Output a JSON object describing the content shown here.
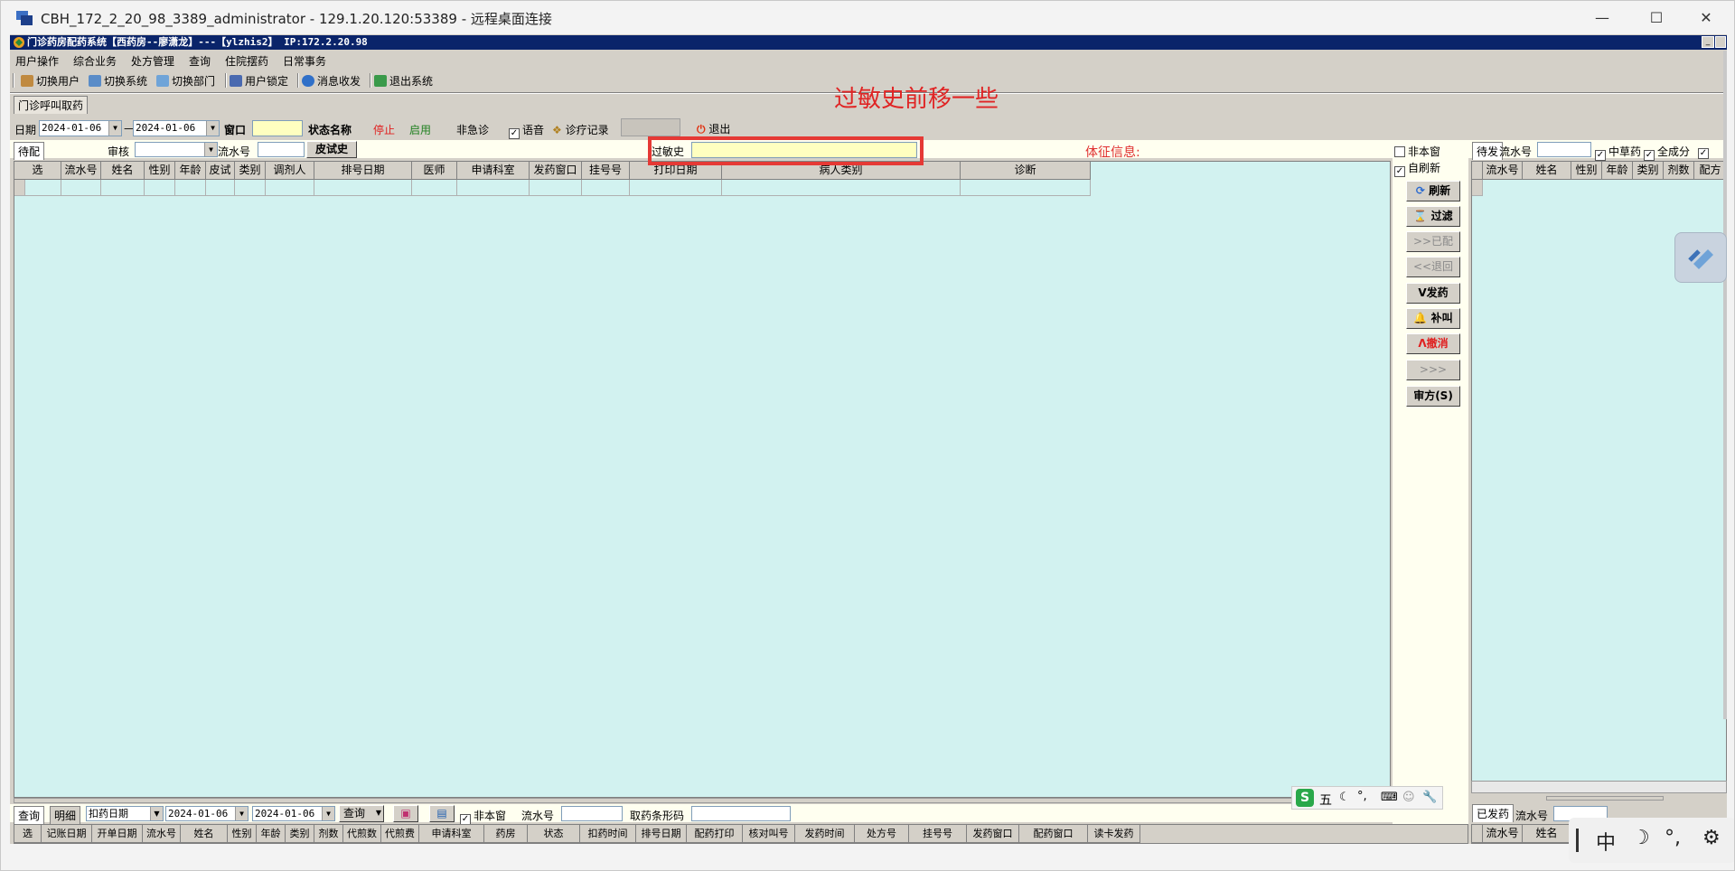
{
  "rdp": {
    "title": "CBH_172_2_20_98_3389_administrator - 129.1.20.120:53389 - 远程桌面连接",
    "minimize": "—",
    "maximize": "☐",
    "close": "✕"
  },
  "app": {
    "title": "门诊药房配药系统【西药房--廖潇龙】---【ylzhis2】 IP:172.2.20.98",
    "menu": [
      "用户操作",
      "综合业务",
      "处方管理",
      "查询",
      "住院摆药",
      "日常事务"
    ],
    "toolbar": [
      "切换用户",
      "切换系统",
      "切换部门",
      "用户锁定",
      "消息收发",
      "退出系统"
    ],
    "tab": "门诊呼叫取药"
  },
  "filter": {
    "date_label": "日期",
    "date_from": "2024-01-06",
    "dash": "—",
    "date_to": "2024-01-06",
    "window_label": "窗口",
    "window_value": "",
    "status_label": "状态名称",
    "stop": "停止",
    "enable": "启用",
    "non_urgent": "非急诊",
    "voice": "语音",
    "visit_record": "诊疗记录",
    "exit": "退出"
  },
  "pending": {
    "tab": "待配",
    "review_label": "审核",
    "serial_label": "流水号",
    "skin_test_btn": "皮试史",
    "allergy_label": "过敏史",
    "vitals_label": "体征信息:",
    "columns": [
      "选",
      "流水号",
      "姓名",
      "性别",
      "年龄",
      "皮试",
      "类别",
      "调剂人",
      "排号日期",
      "医师",
      "申请科室",
      "发药窗口",
      "挂号号",
      "打印日期",
      "病人类别",
      "诊断"
    ]
  },
  "side": {
    "non_window": "非本窗",
    "auto_refresh": "自刷新",
    "buttons": [
      "刷新",
      "过滤",
      ">>已配",
      "<<退回",
      "V发药",
      "补叫",
      "Λ撤消",
      ">>>",
      "审方(S)"
    ]
  },
  "right": {
    "tab": "待发",
    "serial_label": "流水号",
    "chinese_herb": "中草药",
    "all_components": "全成分",
    "columns": [
      "流水号",
      "姓名",
      "性别",
      "年龄",
      "类别",
      "剂数",
      "配方"
    ],
    "dispensed_tab": "已发药",
    "serial_label2": "流水号",
    "columns2": [
      "流水号",
      "姓名"
    ]
  },
  "bottom": {
    "query_tab": "查询",
    "detail_tab": "明细",
    "date_type": "扣药日期",
    "date_from": "2024-01-06",
    "date_to": "2024-01-06",
    "query_btn": "查询",
    "non_window": "非本窗",
    "serial_label": "流水号",
    "barcode_label": "取药条形码",
    "columns": [
      "选",
      "记账日期",
      "开单日期",
      "流水号",
      "姓名",
      "性别",
      "年龄",
      "类别",
      "剂数",
      "代煎数",
      "代煎费",
      "申请科室",
      "药房",
      "状态",
      "扣药时间",
      "排号日期",
      "配药打印",
      "核对叫号",
      "发药时间",
      "处方号",
      "挂号号",
      "发药窗口",
      "配药窗口",
      "读卡发药"
    ]
  },
  "annotation": {
    "text": "过敏史前移一些",
    "color": "#e53935"
  },
  "ime": {
    "mode": "五",
    "lang": "中",
    "punct": "°,"
  }
}
